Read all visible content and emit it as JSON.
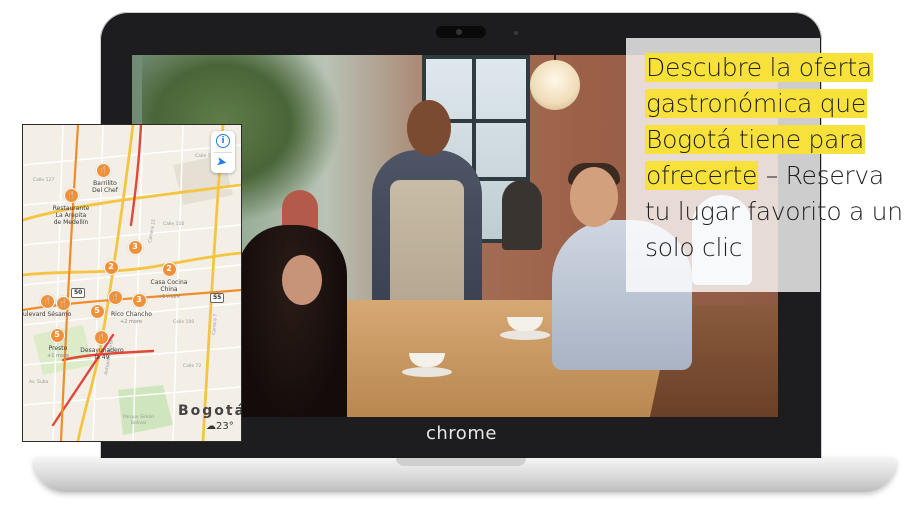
{
  "promo": {
    "highlighted_lines": [
      "Descubre la oferta",
      "gastronómica que",
      "Bogotá tiene para",
      "ofrecerte"
    ],
    "line_end": " – Reserva",
    "tail_lines": [
      "tu lugar favorito a un",
      "solo clic"
    ],
    "highlight_color": "#f7e13a"
  },
  "laptop": {
    "brand": "chrome"
  },
  "map": {
    "city": "Bogotá",
    "weather": "23°",
    "weather_icon": "cloud-icon",
    "controls": [
      "info-icon",
      "location-arrow-icon"
    ],
    "pins": [
      {
        "type": "restaurant",
        "label": "Barrilito\nDel Chef"
      },
      {
        "type": "restaurant",
        "label": "Restaurante\nLa Arepita\nde Medellín"
      },
      {
        "type": "cluster",
        "count": "3"
      },
      {
        "type": "cluster",
        "count": "2"
      },
      {
        "type": "cluster",
        "count": "2",
        "label": "Casa Cocina\nChina",
        "sub": "+1 more"
      },
      {
        "type": "restaurant",
        "label": "ulevard Sésamo"
      },
      {
        "type": "cluster",
        "count": "5"
      },
      {
        "type": "restaurant",
        "label": "Rico Chancho",
        "sub": "+2 more"
      },
      {
        "type": "cluster",
        "count": "3"
      },
      {
        "type": "restaurant",
        "label": "Desayunadero\nla 49"
      },
      {
        "type": "cluster",
        "count": "5",
        "label": "Presto",
        "sub": "+1 more"
      },
      {
        "type": "restaurant"
      }
    ],
    "street_labels": [
      "Calle 134",
      "Calle 127",
      "Calle 116",
      "Calle 100",
      "Calle 72",
      "Carrera 15",
      "Av. Suba",
      "Carrera 7",
      "Autopista Norte",
      "Parque Simón Bolívar"
    ],
    "route_shields": [
      "50",
      "55"
    ]
  }
}
